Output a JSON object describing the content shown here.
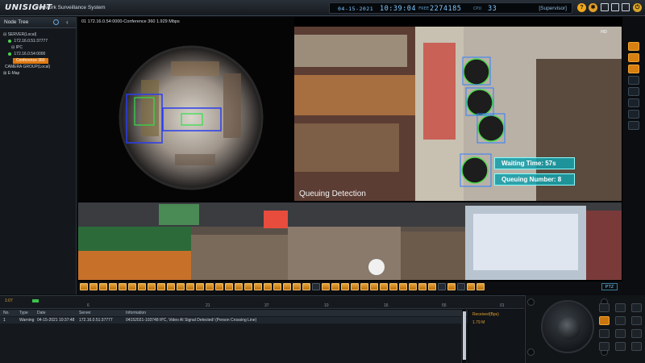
{
  "header": {
    "logo": "UNISIGHT",
    "app_title": "Network Surveillance System",
    "date": "04-15-2021",
    "time": "10:39:04",
    "free_label": "FREE",
    "free_value": "2274185",
    "cpu_label": "CPU",
    "cpu_value": "33",
    "user": "[Supervisor]"
  },
  "sidebar": {
    "title": "Node Tree",
    "items": [
      {
        "label": "SERVER(Local)"
      },
      {
        "label": "172.16.0.51:37777"
      },
      {
        "label": "IPC"
      },
      {
        "label": "172.16.0.54:0000"
      },
      {
        "label": "Conference 360"
      },
      {
        "label": "CAMERA GROUP(Local)"
      },
      {
        "label": "E-Map"
      }
    ]
  },
  "video": {
    "tile1_label": "01  172.16.0.54:0000-Conference 360  1.929 Mbps",
    "tile2_hd": "HD",
    "waiting_time": "Waiting Time: 57s",
    "queuing_number": "Queuing Number: 8",
    "queuing_detection": "Queuing Detection",
    "ptz": "PTZ"
  },
  "timeline": {
    "ticks": [
      "6",
      "21",
      "37",
      "10",
      "16",
      "55",
      "01"
    ],
    "marker": "1:07"
  },
  "log": {
    "headers": [
      "No.",
      "Type",
      "Date",
      "Server",
      "Information"
    ],
    "rows": [
      {
        "no": "1",
        "type": "Warning",
        "date": "04-15-2021 10:37:48",
        "server": "172.16.0.51:37777",
        "info": "04152021-103748  IPC, Video AI Signal Detected! (Person Crossing Line)"
      }
    ],
    "received_label": "Received(Bps)",
    "received_value": "1.79 M"
  },
  "colors": {
    "accent_orange": "#e07a12",
    "status_blue": "#7fc6ff",
    "alert_cyan": "#29c4c4"
  }
}
